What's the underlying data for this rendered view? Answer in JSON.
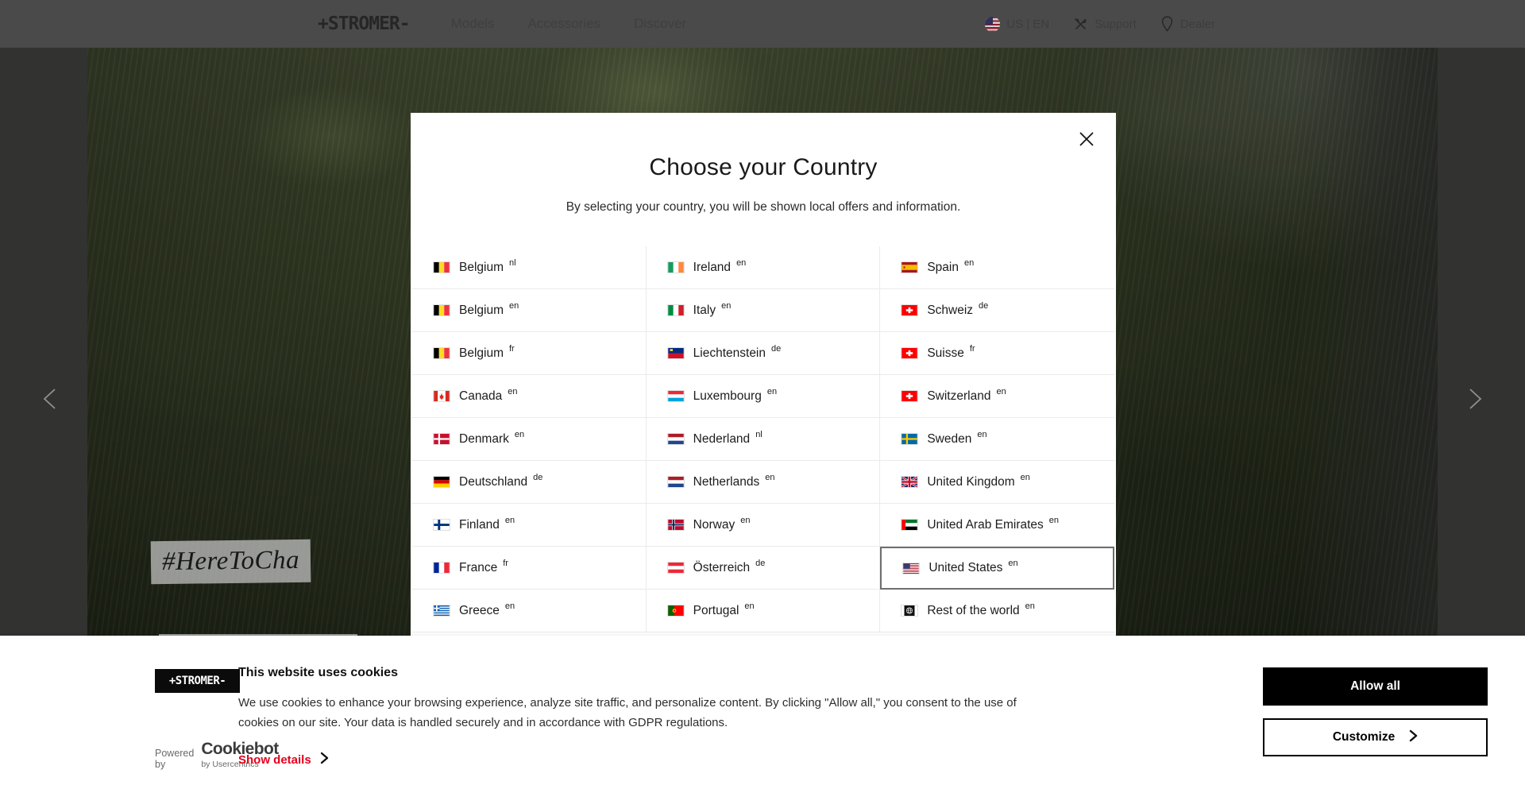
{
  "topnav": {
    "brand": "+STROMER-",
    "links": [
      {
        "label": "Models"
      },
      {
        "label": "Accessories"
      },
      {
        "label": "Discover"
      }
    ],
    "locale": "US | EN",
    "support": "Support",
    "dealer": "Dealer"
  },
  "hero": {
    "tagline": "#HereToCha",
    "prev_label": "Previous slide",
    "next_label": "Next slide"
  },
  "modal": {
    "title": "Choose your Country",
    "subtitle": "By selecting your country, you will be shown local offers and information.",
    "close_label": "Close",
    "countries": [
      {
        "name": "Belgium",
        "lang": "nl",
        "flag": "be",
        "selected": false
      },
      {
        "name": "Ireland",
        "lang": "en",
        "flag": "ie",
        "selected": false
      },
      {
        "name": "Spain",
        "lang": "en",
        "flag": "es",
        "selected": false
      },
      {
        "name": "Belgium",
        "lang": "en",
        "flag": "be",
        "selected": false
      },
      {
        "name": "Italy",
        "lang": "en",
        "flag": "it",
        "selected": false
      },
      {
        "name": "Schweiz",
        "lang": "de",
        "flag": "ch",
        "selected": false
      },
      {
        "name": "Belgium",
        "lang": "fr",
        "flag": "be",
        "selected": false
      },
      {
        "name": "Liechtenstein",
        "lang": "de",
        "flag": "li",
        "selected": false
      },
      {
        "name": "Suisse",
        "lang": "fr",
        "flag": "ch",
        "selected": false
      },
      {
        "name": "Canada",
        "lang": "en",
        "flag": "ca",
        "selected": false
      },
      {
        "name": "Luxembourg",
        "lang": "en",
        "flag": "lu",
        "selected": false
      },
      {
        "name": "Switzerland",
        "lang": "en",
        "flag": "ch",
        "selected": false
      },
      {
        "name": "Denmark",
        "lang": "en",
        "flag": "dk",
        "selected": false
      },
      {
        "name": "Nederland",
        "lang": "nl",
        "flag": "nl",
        "selected": false
      },
      {
        "name": "Sweden",
        "lang": "en",
        "flag": "se",
        "selected": false
      },
      {
        "name": "Deutschland",
        "lang": "de",
        "flag": "de",
        "selected": false
      },
      {
        "name": "Netherlands",
        "lang": "en",
        "flag": "nl",
        "selected": false
      },
      {
        "name": "United Kingdom",
        "lang": "en",
        "flag": "gb",
        "selected": false
      },
      {
        "name": "Finland",
        "lang": "en",
        "flag": "fi",
        "selected": false
      },
      {
        "name": "Norway",
        "lang": "en",
        "flag": "no",
        "selected": false
      },
      {
        "name": "United Arab Emirates",
        "lang": "en",
        "flag": "ae",
        "selected": false
      },
      {
        "name": "France",
        "lang": "fr",
        "flag": "fr",
        "selected": false
      },
      {
        "name": "Österreich",
        "lang": "de",
        "flag": "at",
        "selected": false
      },
      {
        "name": "United States",
        "lang": "en",
        "flag": "us",
        "selected": true
      },
      {
        "name": "Greece",
        "lang": "en",
        "flag": "gr",
        "selected": false
      },
      {
        "name": "Portugal",
        "lang": "en",
        "flag": "pt",
        "selected": false
      },
      {
        "name": "Rest of the world",
        "lang": "en",
        "flag": "globe",
        "selected": false
      }
    ]
  },
  "cookie": {
    "logo": "+STROMER-",
    "heading": "This website uses cookies",
    "paragraph": "We use cookies to enhance your browsing experience, analyze site traffic, and personalize content. By clicking \"Allow all,\" you consent to the use of cookies on our site. Your data is handled securely and in accordance with GDPR regulations.",
    "show_details": "Show details",
    "powered_by": "Powered by",
    "cookiebot_name": "Cookiebot",
    "cookiebot_by": "by Usercentrics",
    "allow_all": "Allow all",
    "customize": "Customize",
    "link_color": "#e4001b"
  }
}
